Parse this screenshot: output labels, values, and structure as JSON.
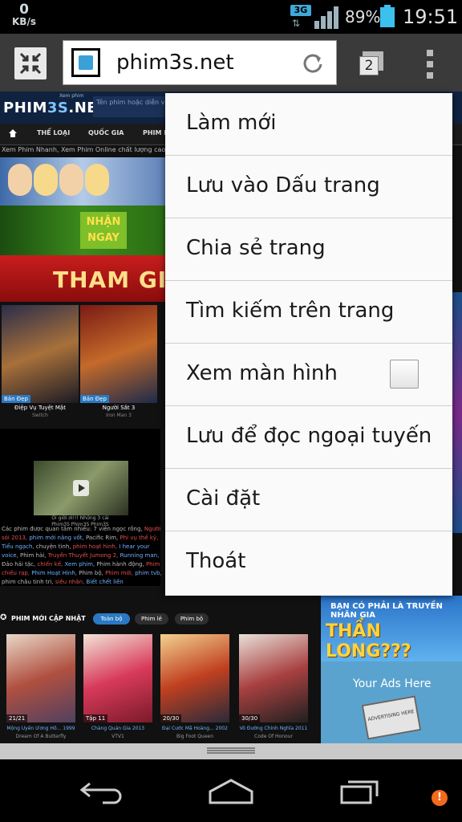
{
  "status_bar": {
    "net_speed_value": "0",
    "net_speed_unit": "KB/s",
    "network_type": "3G",
    "battery_percent": "89%",
    "time": "19:51",
    "icons": [
      "signal-icon",
      "battery-icon"
    ]
  },
  "browser": {
    "url": "phim3s.net",
    "tab_count": "2",
    "icons": [
      "fullscreen-icon",
      "favicon",
      "reload-icon",
      "tabs-icon",
      "overflow-menu-icon"
    ]
  },
  "website": {
    "logo_prefix": "PHIM",
    "logo_accent": "3S",
    "logo_suffix": ".NET",
    "logo_small": "Xem phim",
    "search_placeholder": "Tên phim hoặc diễn viên",
    "nav": [
      "THỂ LOẠI",
      "QUỐC GIA",
      "PHIM LẺ"
    ],
    "tagline": "Xem Phim Nhanh, Xem Phim Online chất lượng cao miễn phí",
    "banner2_cta": [
      "NHẬN",
      "NGAY"
    ],
    "banner3_text": "THAM GIA",
    "featured": [
      {
        "badge": "Bản Đẹp",
        "title": "Điệp Vụ Tuyệt Mật",
        "subtitle": "Switch"
      },
      {
        "badge": "Bản Đẹp",
        "title": "Người Sắt 3",
        "subtitle": "Iron Man 3"
      }
    ],
    "video_caption": [
      "Ôi giời ơi!!! Những 3 cái",
      "Phim3S Phim3S Phim3S"
    ],
    "seo_text": {
      "intro": "Các phim được quan tâm nhiều:",
      "items": [
        "7 viên ngọc rồng",
        "Người sói 2013",
        "phim mới nâng vốt",
        "Pacific Rim",
        "Phi vụ thế kỷ",
        "Tiểu ngạch",
        "chuyện tình",
        "phim hoạt hình",
        "I hear your voice",
        "Phim hài",
        "Truyền Thuyết Jumong 2",
        "Running man",
        "Đảo hải tặc",
        "chiến kế",
        "Xem phim",
        "Phim hành động",
        "Phim chiếu rạp",
        "Phim Hoạt Hình",
        "Phim bộ",
        "Phim mới",
        "phim tvb",
        "phim châu tinh trì",
        "siêu nhân",
        "Biết chết liền"
      ]
    },
    "right_banner": {
      "line1": "BẠN CÓ PHẢI LÀ TRUYỀN NHÂN GIA",
      "line2": "THẦN LONG???"
    },
    "ads_text": "Your Ads Here",
    "ads_sign": "ADVERTISING HERE",
    "new_movies": {
      "title": "PHIM MỚI CẬP NHẬT",
      "filters": [
        "Toàn bộ",
        "Phim lẻ",
        "Phim bộ"
      ],
      "items": [
        {
          "episode": "21/21",
          "title": "Mộng Uyên Ương Hồ... 1999",
          "subtitle": "Dream Of A Butterfly"
        },
        {
          "episode": "Tập 11",
          "title": "Chàng Quản Gia 2013",
          "subtitle": "VTV1"
        },
        {
          "episode": "20/30",
          "title": "Đại Cước Mã Hoàng... 2002",
          "subtitle": "Big Foot Queen"
        },
        {
          "episode": "30/30",
          "title": "Vô Đường Chính Nghĩa 2011",
          "subtitle": "Code Of Honour"
        }
      ]
    }
  },
  "menu": {
    "items": [
      "Làm mới",
      "Lưu vào Dấu trang",
      "Chia sẻ trang",
      "Tìm kiếm trên trang",
      "Xem màn hình",
      "Lưu để đọc ngoại tuyến",
      "Cài đặt",
      "Thoát"
    ],
    "desktop_view_checked": false
  },
  "nav_bar": {
    "icons": [
      "back-icon",
      "home-icon",
      "recents-icon"
    ],
    "notification_badge": "!"
  },
  "colors": {
    "toolbar": "#3a3a3a",
    "menu_bg": "#fafafa",
    "site_header": "#0f2240",
    "accent_blue": "#3aa0d8"
  }
}
